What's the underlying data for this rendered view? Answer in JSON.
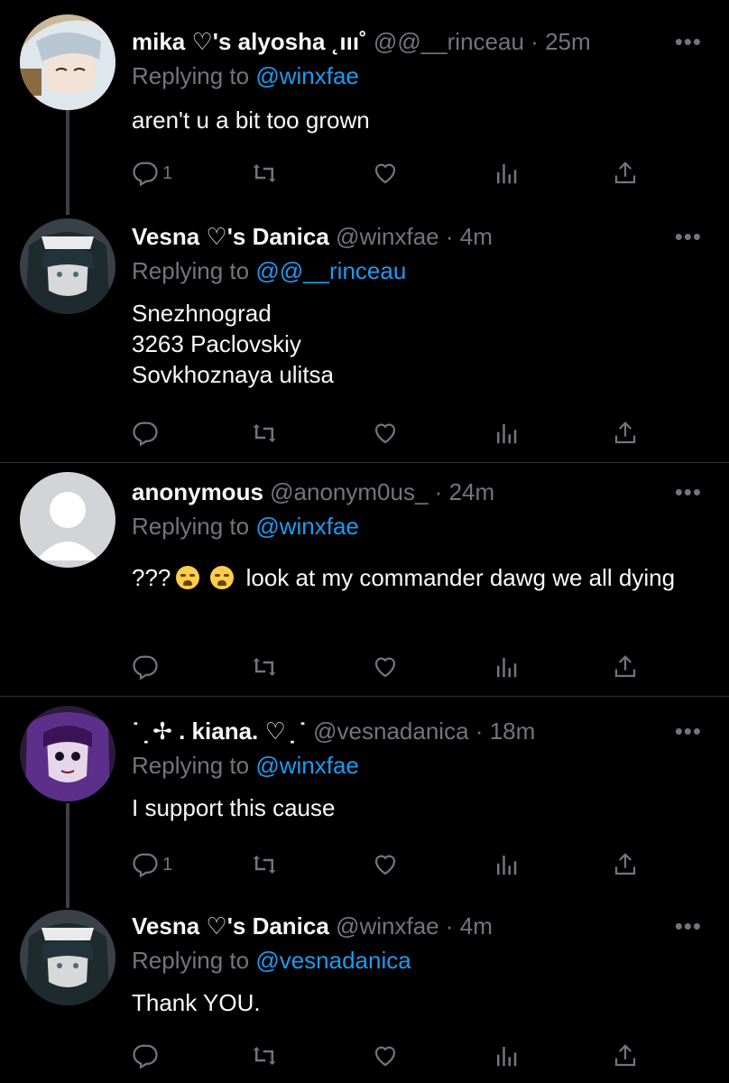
{
  "tweets": [
    {
      "name": "mika ♡'s alyosha ˛ııı˚",
      "handle": "@@__rinceau",
      "sep": "·",
      "time": "25m",
      "reply_prefix": "Replying to",
      "reply_to": "@winxfae",
      "text": "aren't u a bit too grown",
      "reply_count": "1",
      "avatar": "white-haired anime character icon"
    },
    {
      "name": "Vesna ♡'s Danica",
      "handle": "@winxfae",
      "sep": "·",
      "time": "4m",
      "reply_prefix": "Replying to",
      "reply_to": "@@__rinceau",
      "text": "Snezhnograd\n3263 Paclovskiy\nSovkhoznaya ulitsa",
      "reply_count": "",
      "avatar": "maid anime character icon"
    },
    {
      "name": "anonymous",
      "handle": "@anonym0us_",
      "sep": "·",
      "time": "24m",
      "reply_prefix": "Replying to",
      "reply_to": "@winxfae",
      "text_start": "???",
      "text_end": " look at my commander dawg we all dying",
      "reply_count": "",
      "avatar": "default profile icon"
    },
    {
      "name": "˙ ̣ ✢ . kiana. ♡ ̣ ˙",
      "handle": "@vesnadanica",
      "sep": "·",
      "time": "18m",
      "reply_prefix": "Replying to",
      "reply_to": "@winxfae",
      "text": "I support this cause",
      "reply_count": "1",
      "avatar": "purple haired doll icon"
    },
    {
      "name": "Vesna ♡'s Danica",
      "handle": "@winxfae",
      "sep": "·",
      "time": "4m",
      "reply_prefix": "Replying to",
      "reply_to": "@vesnadanica",
      "text": "Thank YOU.",
      "reply_count": "",
      "avatar": "maid anime character icon"
    }
  ],
  "more_label": "•••",
  "colors": {
    "bg": "#000000",
    "text": "#f7f9f9",
    "muted": "#71767b",
    "link": "#1d9bf0",
    "divider": "#2f3336"
  }
}
